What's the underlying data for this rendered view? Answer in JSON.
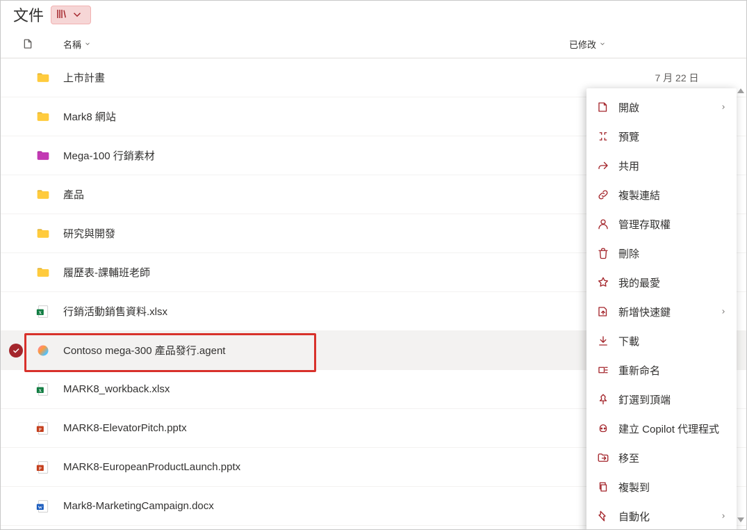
{
  "header": {
    "title": "文件"
  },
  "columns": {
    "name": "名稱",
    "modified": "已修改"
  },
  "rows": [
    {
      "type": "folder",
      "color": "#ffcb3d",
      "name": "上市計畫",
      "modified": "7 月 22 日"
    },
    {
      "type": "folder",
      "color": "#ffcb3d",
      "name": "Mark8 網站",
      "modified": ""
    },
    {
      "type": "folder",
      "color": "#c239b3",
      "name": "Mega-100 行銷素材",
      "modified": ""
    },
    {
      "type": "folder",
      "color": "#ffcb3d",
      "name": "產品",
      "modified": ""
    },
    {
      "type": "folder",
      "color": "#ffcb3d",
      "name": "研究與開發",
      "modified": ""
    },
    {
      "type": "folder",
      "color": "#ffcb3d",
      "name": "履歷表-課輔班老師",
      "modified": ""
    },
    {
      "type": "xlsx",
      "name": "行銷活動銷售資料.xlsx",
      "modified": ""
    },
    {
      "type": "agent",
      "name": "Contoso mega-300 產品發行.agent",
      "modified": "",
      "selected": true
    },
    {
      "type": "xlsx",
      "name": "MARK8_workback.xlsx",
      "modified": ""
    },
    {
      "type": "pptx",
      "name": "MARK8-ElevatorPitch.pptx",
      "modified": ""
    },
    {
      "type": "pptx",
      "name": "MARK8-EuropeanProductLaunch.pptx",
      "modified": ""
    },
    {
      "type": "docx",
      "name": "Mark8-MarketingCampaign.docx",
      "modified": ""
    }
  ],
  "context_menu": [
    {
      "id": "open",
      "label": "開啟",
      "arrow": true,
      "icon": "open"
    },
    {
      "id": "preview",
      "label": "預覽",
      "icon": "preview"
    },
    {
      "id": "share",
      "label": "共用",
      "icon": "share"
    },
    {
      "id": "copylink",
      "label": "複製連結",
      "icon": "link"
    },
    {
      "id": "access",
      "label": "管理存取權",
      "icon": "person"
    },
    {
      "id": "delete",
      "label": "刪除",
      "icon": "trash"
    },
    {
      "id": "favorite",
      "label": "我的最愛",
      "icon": "star"
    },
    {
      "id": "shortcut",
      "label": "新增快速鍵",
      "arrow": true,
      "icon": "shortcut"
    },
    {
      "id": "download",
      "label": "下載",
      "icon": "download"
    },
    {
      "id": "rename",
      "label": "重新命名",
      "icon": "rename"
    },
    {
      "id": "pin",
      "label": "釘選到頂端",
      "icon": "pin"
    },
    {
      "id": "copilot",
      "label": "建立 Copilot 代理程式",
      "icon": "copilot"
    },
    {
      "id": "moveto",
      "label": "移至",
      "icon": "moveto"
    },
    {
      "id": "copyto",
      "label": "複製到",
      "icon": "copyto"
    },
    {
      "id": "automate",
      "label": "自動化",
      "arrow": true,
      "icon": "automate"
    }
  ],
  "colors": {
    "accent": "#a4262c",
    "highlight": "#d8312b"
  }
}
